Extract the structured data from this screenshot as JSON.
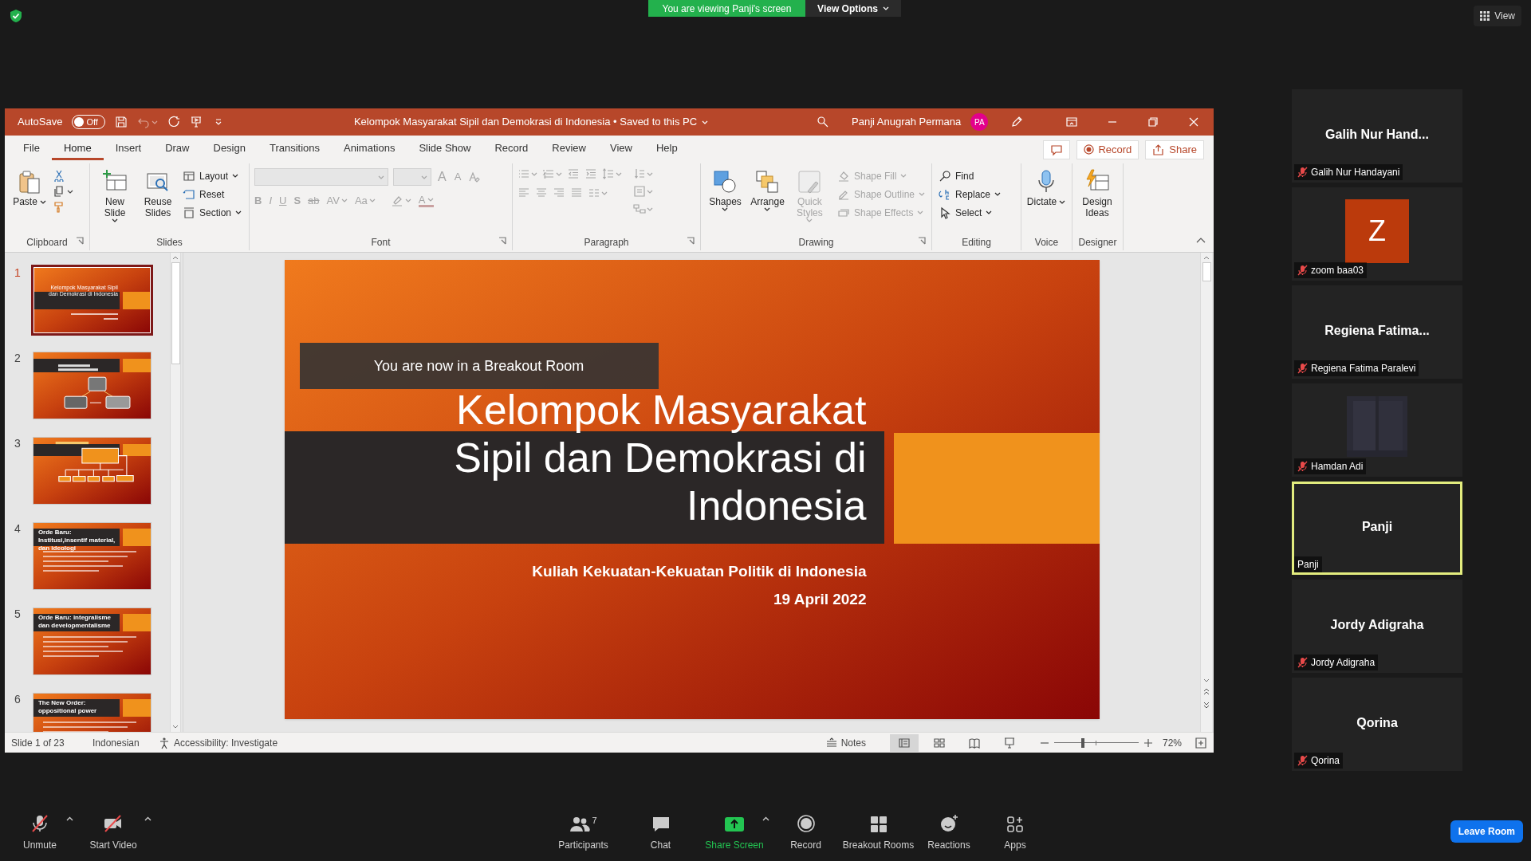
{
  "meeting_bar": {
    "viewing_banner": "You are viewing Panji's screen",
    "view_options": "View Options",
    "view_button": "View"
  },
  "powerpoint": {
    "title_bar": {
      "autosave_label": "AutoSave",
      "autosave_toggle": "Off",
      "autosave_on": false,
      "document_title": "Kelompok Masyarakat Sipil dan Demokrasi di Indonesia • Saved to this PC",
      "user_name": "Panji Anugrah Permana",
      "user_initials": "PA"
    },
    "tabs": [
      {
        "label": "File",
        "selected": false
      },
      {
        "label": "Home",
        "selected": true
      },
      {
        "label": "Insert",
        "selected": false
      },
      {
        "label": "Draw",
        "selected": false
      },
      {
        "label": "Design",
        "selected": false
      },
      {
        "label": "Transitions",
        "selected": false
      },
      {
        "label": "Animations",
        "selected": false
      },
      {
        "label": "Slide Show",
        "selected": false
      },
      {
        "label": "Record",
        "selected": false
      },
      {
        "label": "Review",
        "selected": false
      },
      {
        "label": "View",
        "selected": false
      },
      {
        "label": "Help",
        "selected": false
      }
    ],
    "tab_actions": [
      "Record",
      "Share"
    ],
    "ribbon": [
      {
        "label": "Clipboard",
        "launcher": true,
        "paste": {
          "label": "Paste",
          "menu": true
        }
      },
      {
        "label": "Slides",
        "launcher": false,
        "large": [
          {
            "label": "New Slide",
            "menu": true
          },
          {
            "label": "Reuse Slides",
            "menu": false
          }
        ],
        "small": [
          {
            "label": "Layout",
            "menu": true
          },
          {
            "label": "Reset",
            "menu": false
          },
          {
            "label": "Section",
            "menu": true
          }
        ]
      },
      {
        "label": "Font",
        "launcher": true,
        "disabled": true,
        "size_buttons": [
          "A",
          "A"
        ],
        "format_buttons": [
          "B",
          "I",
          "U",
          "S",
          "ab",
          "AV",
          "Aa"
        ],
        "color_button": "A"
      },
      {
        "label": "Paragraph",
        "launcher": true,
        "disabled": true
      },
      {
        "label": "Drawing",
        "launcher": true,
        "large": [
          {
            "label": "Shapes",
            "menu": true,
            "disabled": false
          },
          {
            "label": "Arrange",
            "menu": true,
            "disabled": false
          },
          {
            "label": "Quick Styles",
            "menu": true,
            "disabled": true
          }
        ],
        "small": [
          {
            "label": "Shape Fill",
            "menu": true,
            "disabled": true
          },
          {
            "label": "Shape Outline",
            "menu": true,
            "disabled": true
          },
          {
            "label": "Shape Effects",
            "menu": true,
            "disabled": true
          }
        ]
      },
      {
        "label": "Editing",
        "launcher": false,
        "small": [
          {
            "label": "Find",
            "menu": false
          },
          {
            "label": "Replace",
            "menu": true
          },
          {
            "label": "Select",
            "menu": true
          }
        ]
      },
      {
        "label": "Voice",
        "launcher": false,
        "large": [
          {
            "label": "Dictate",
            "menu": true
          }
        ]
      },
      {
        "label": "Designer",
        "launcher": false,
        "large": [
          {
            "label": "Design Ideas",
            "menu": false
          }
        ]
      }
    ],
    "slides": [
      {
        "number": "1",
        "selected": true,
        "kind": "title",
        "title": "Kelompok Masyarakat Sipil dan Demokrasi di Indonesia"
      },
      {
        "number": "2",
        "selected": false,
        "kind": "photos"
      },
      {
        "number": "3",
        "selected": false,
        "kind": "org-chart"
      },
      {
        "number": "4",
        "selected": false,
        "kind": "bullets",
        "title": "Orde Baru: Institusi,insentif material, dan ideologi"
      },
      {
        "number": "5",
        "selected": false,
        "kind": "bullets",
        "title": "Orde Baru: integralisme dan developmentalisme"
      },
      {
        "number": "6",
        "selected": false,
        "kind": "bullets",
        "title": "The New Order: oppositional power"
      }
    ],
    "current_slide": {
      "title": "Kelompok Masyarakat Sipil dan Demokrasi di Indonesia",
      "subtitle": "Kuliah Kekuatan-Kekuatan Politik di Indonesia",
      "date": "19 April 2022"
    },
    "breakout_notice": "You are now in a Breakout Room",
    "status_bar": {
      "slide_counter": "Slide 1 of 23",
      "language": "Indonesian",
      "accessibility": "Accessibility: Investigate",
      "notes": "Notes",
      "views": [
        {
          "selected": true
        },
        {
          "selected": false
        },
        {
          "selected": false
        },
        {
          "selected": false
        }
      ],
      "zoom": {
        "level": 0.34,
        "reading": "72%"
      }
    }
  },
  "participants": [
    {
      "kind": "name",
      "display": "Galih Nur Hand...",
      "name": "Galih Nur Handayani",
      "muted": true,
      "speaking": false
    },
    {
      "kind": "avatar",
      "avatar": "Z",
      "name": "zoom baa03",
      "muted": true,
      "speaking": false
    },
    {
      "kind": "name",
      "display": "Regiena Fatima...",
      "name": "Regiena Fatima Paralevi",
      "muted": true,
      "speaking": false
    },
    {
      "kind": "video",
      "name": "Hamdan Adi",
      "muted": true,
      "speaking": false
    },
    {
      "kind": "name",
      "display": "Panji",
      "name": "Panji",
      "muted": false,
      "speaking": true
    },
    {
      "kind": "name",
      "display": "Jordy Adigraha",
      "name": "Jordy Adigraha",
      "muted": true,
      "speaking": false
    },
    {
      "kind": "name",
      "display": "Qorina",
      "name": "Qorina",
      "muted": true,
      "speaking": false
    }
  ],
  "toolbar": {
    "left": [
      {
        "kind": "mic",
        "label": "Unmute",
        "menu": true
      },
      {
        "kind": "camera",
        "label": "Start Video",
        "menu": true
      }
    ],
    "center": [
      {
        "kind": "people",
        "label": "Participants",
        "count": "7",
        "menu": false
      },
      {
        "kind": "chat",
        "label": "Chat",
        "menu": false
      },
      {
        "kind": "share",
        "label": "Share Screen",
        "menu": true
      },
      {
        "kind": "record",
        "label": "Record",
        "menu": false
      },
      {
        "kind": "grid",
        "label": "Breakout Rooms",
        "menu": false
      },
      {
        "kind": "reaction",
        "label": "Reactions",
        "menu": false
      },
      {
        "kind": "apps",
        "label": "Apps",
        "menu": false
      }
    ],
    "leave": "Leave Room"
  }
}
